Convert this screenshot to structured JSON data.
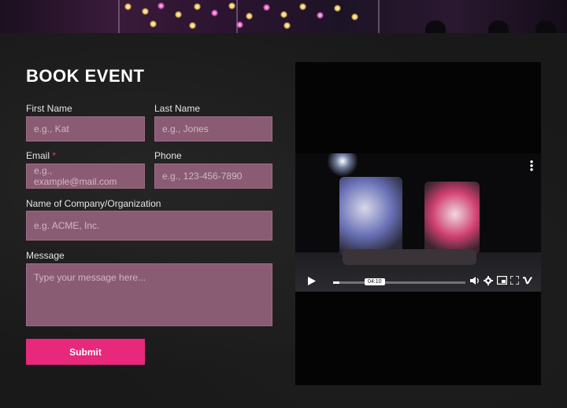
{
  "form": {
    "title": "BOOK EVENT",
    "first_name": {
      "label": "First Name",
      "placeholder": "e.g., Kat"
    },
    "last_name": {
      "label": "Last Name",
      "placeholder": "e.g., Jones"
    },
    "email": {
      "label": "Email",
      "required_mark": "*",
      "placeholder": "e.g., example@mail.com"
    },
    "phone": {
      "label": "Phone",
      "placeholder": "e.g., 123-456-7890"
    },
    "company": {
      "label": "Name of Company/Organization",
      "placeholder": "e.g. ACME, Inc."
    },
    "message": {
      "label": "Message",
      "placeholder": "Type your message here..."
    },
    "submit_label": "Submit"
  },
  "video": {
    "timestamp": "04:10",
    "progress": 0.05,
    "icons": [
      "play-icon",
      "volume-icon",
      "settings-icon",
      "pip-icon",
      "fullscreen-icon",
      "vimeo-logo-icon",
      "more-options-icon"
    ]
  },
  "colors": {
    "accent": "#e8287a",
    "field_bg": "#8a5c74",
    "background": "#191919"
  }
}
